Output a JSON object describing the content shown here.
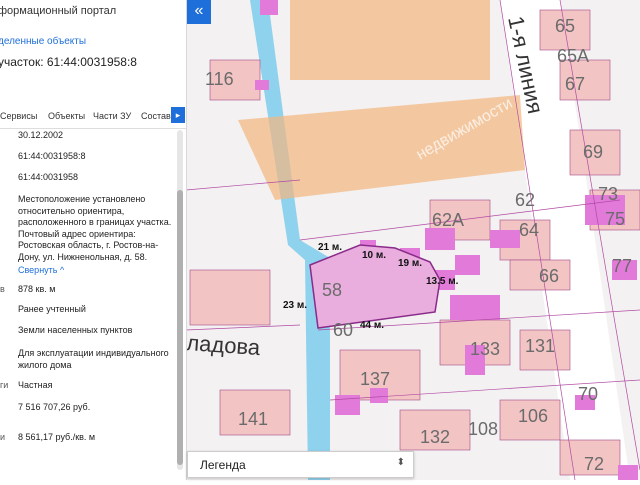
{
  "panel": {
    "portal_title": "формационный портал",
    "selected_link": "деленные объекты",
    "parcel_title": "участок: 61:44:0031958:8",
    "tabs": [
      "Сервисы",
      "Объекты",
      "Части ЗУ",
      "Состав"
    ],
    "fields": [
      {
        "value": "30.12.2002"
      },
      {
        "value": "61:44:0031958:8"
      },
      {
        "value": "61:44:0031958"
      },
      {
        "value": "Местоположение установлено относительно ориентира, расположенного в границах участка. Почтовый адрес ориентира: Ростовская область, г. Ростов-на-Дону, ул. Нижненольная, д. 58."
      },
      {
        "label": "в",
        "value": "878 кв. м"
      },
      {
        "value": "Ранее учтенный"
      },
      {
        "value": "Земли населенных пунктов"
      },
      {
        "value": "Для эксплуатации индивидуального жилого дома"
      },
      {
        "label": "ги",
        "value": "Частная"
      },
      {
        "value": "7 516 707,26 руб."
      },
      {
        "label": "и",
        "value": "8 561,17 руб./кв. м"
      }
    ],
    "collapse_label": "Свернуть ^"
  },
  "map": {
    "collapse_icon": "«",
    "street_labels": [
      "1-я линия",
      "ладова"
    ],
    "house_numbers": [
      "116",
      "65",
      "65А",
      "67",
      "69",
      "73",
      "75",
      "77",
      "62",
      "62А",
      "64",
      "66",
      "58",
      "60",
      "133",
      "131",
      "137",
      "141",
      "132",
      "108",
      "106",
      "70",
      "72"
    ],
    "measurements": [
      "21 м.",
      "10 м.",
      "19 м.",
      "13.5 м.",
      "23 м.",
      "44 м."
    ],
    "watermark": "недвижимости",
    "colors": {
      "building": "#f0b3b3",
      "highlight": "#e27ad9",
      "selected": "#e9aede",
      "road": "#8fd2ee",
      "school": "#f2b77f"
    }
  },
  "legend": {
    "label": "Легенда",
    "chevron": "⬍"
  }
}
